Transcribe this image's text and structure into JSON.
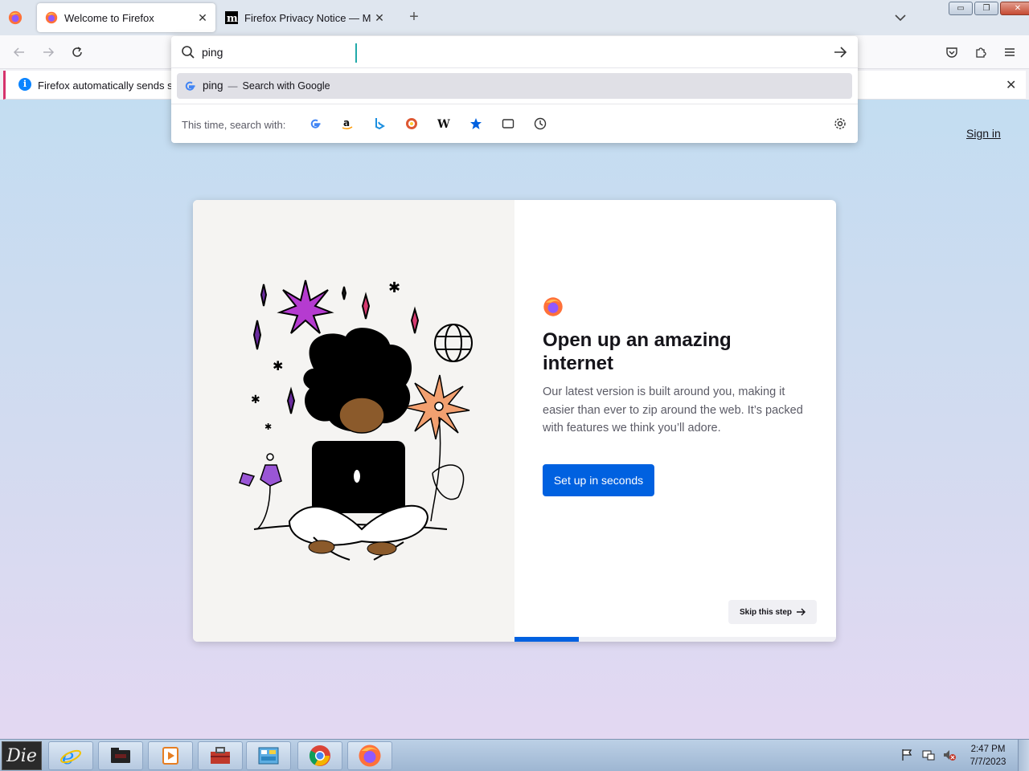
{
  "browser": {
    "tabs": [
      {
        "title": "Welcome to Firefox",
        "active": true,
        "favicon": "firefox-icon"
      },
      {
        "title": "Firefox Privacy Notice — Mozill",
        "active": false,
        "favicon": "mozilla-m-icon"
      }
    ],
    "new_tab_symbol": "+",
    "close_symbol": "✕"
  },
  "window_controls": {
    "minimize": "▭",
    "restore": "❐",
    "close": "✕"
  },
  "urlbar": {
    "value": "ping",
    "suggestion": {
      "query": "ping",
      "separator": "—",
      "action": "Search with Google"
    },
    "one_offs": {
      "label": "This time, search with:",
      "engines": [
        "google",
        "amazon",
        "bing",
        "duckduckgo",
        "wikipedia",
        "bookmarks",
        "tabs",
        "history"
      ]
    }
  },
  "notification": {
    "text": "Firefox automatically sends som",
    "icon": "info-icon"
  },
  "page": {
    "sign_in": "Sign in",
    "heading": "Open up an amazing internet",
    "description": "Our latest version is built around you, making it easier than ever to zip around the web. It’s packed with features we think you’ll adore.",
    "primary_button": "Set up in seconds",
    "skip_button": "Skip this step",
    "progress": 0.2
  },
  "taskbar": {
    "start_label": "Die",
    "items": [
      "internet-explorer",
      "file-explorer",
      "media-player",
      "toolbox",
      "control-panel",
      "chrome",
      "firefox"
    ],
    "clock": {
      "time": "2:47 PM",
      "date": "7/7/2023"
    }
  },
  "colors": {
    "accent": "#0061e0",
    "notification_border": "#d6336c",
    "info_blue": "#0a84ff"
  }
}
